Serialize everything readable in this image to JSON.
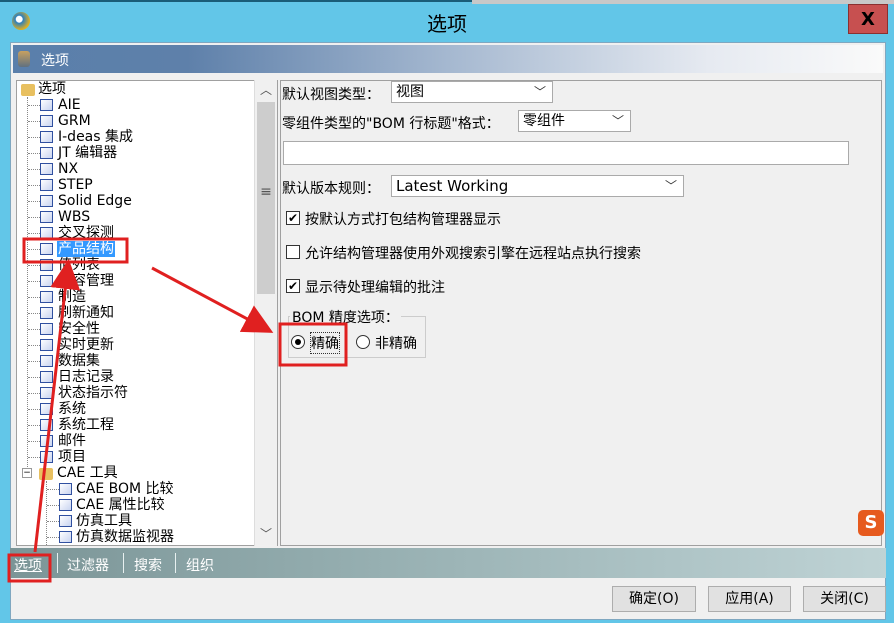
{
  "window": {
    "title": "选项",
    "close_label": "X"
  },
  "header": {
    "title": "选项"
  },
  "tree": {
    "root": "选项",
    "items": [
      "AIE",
      "GRM",
      "I-deas 集成",
      "JT 编辑器",
      "NX",
      "STEP",
      "Solid Edge",
      "WBS",
      "交叉探测",
      "产品结构",
      "值列表",
      "内容管理",
      "制造",
      "刷新通知",
      "安全性",
      "实时更新",
      "数据集",
      "日志记录",
      "状态指示符",
      "系统",
      "系统工程",
      "邮件",
      "项目"
    ],
    "selected": "产品结构",
    "group": "CAE 工具",
    "group_items": [
      "CAE BOM 比较",
      "CAE 属性比较",
      "仿真工具",
      "仿真数据监视器"
    ]
  },
  "form": {
    "view_type_label": "默认视图类型：",
    "view_type_value": "视图",
    "bom_title_label": "零组件类型的\"BOM 行标题\"格式：",
    "bom_title_value": "零组件",
    "text_value": "",
    "revision_rule_label": "默认版本规则：",
    "revision_rule_value": "Latest Working",
    "checkboxes": [
      {
        "label": "按默认方式打包结构管理器显示",
        "checked": true
      },
      {
        "label": "允许结构管理器使用外观搜索引擎在远程站点执行搜索",
        "checked": false
      },
      {
        "label": "显示待处理编辑的批注",
        "checked": true
      }
    ],
    "precision_group": "BOM 精度选项：",
    "precision_options": [
      {
        "label": "精确",
        "selected": true
      },
      {
        "label": "非精确",
        "selected": false
      }
    ]
  },
  "tabs": [
    "选项",
    "过滤器",
    "搜索",
    "组织"
  ],
  "active_tab": "选项",
  "buttons": {
    "ok": "确定(O)",
    "apply": "应用(A)",
    "close": "关闭(C)"
  },
  "colors": {
    "titlebar": "#62c6e8",
    "close": "#c75050",
    "selection": "#3399ff",
    "annotation": "#e02020"
  }
}
